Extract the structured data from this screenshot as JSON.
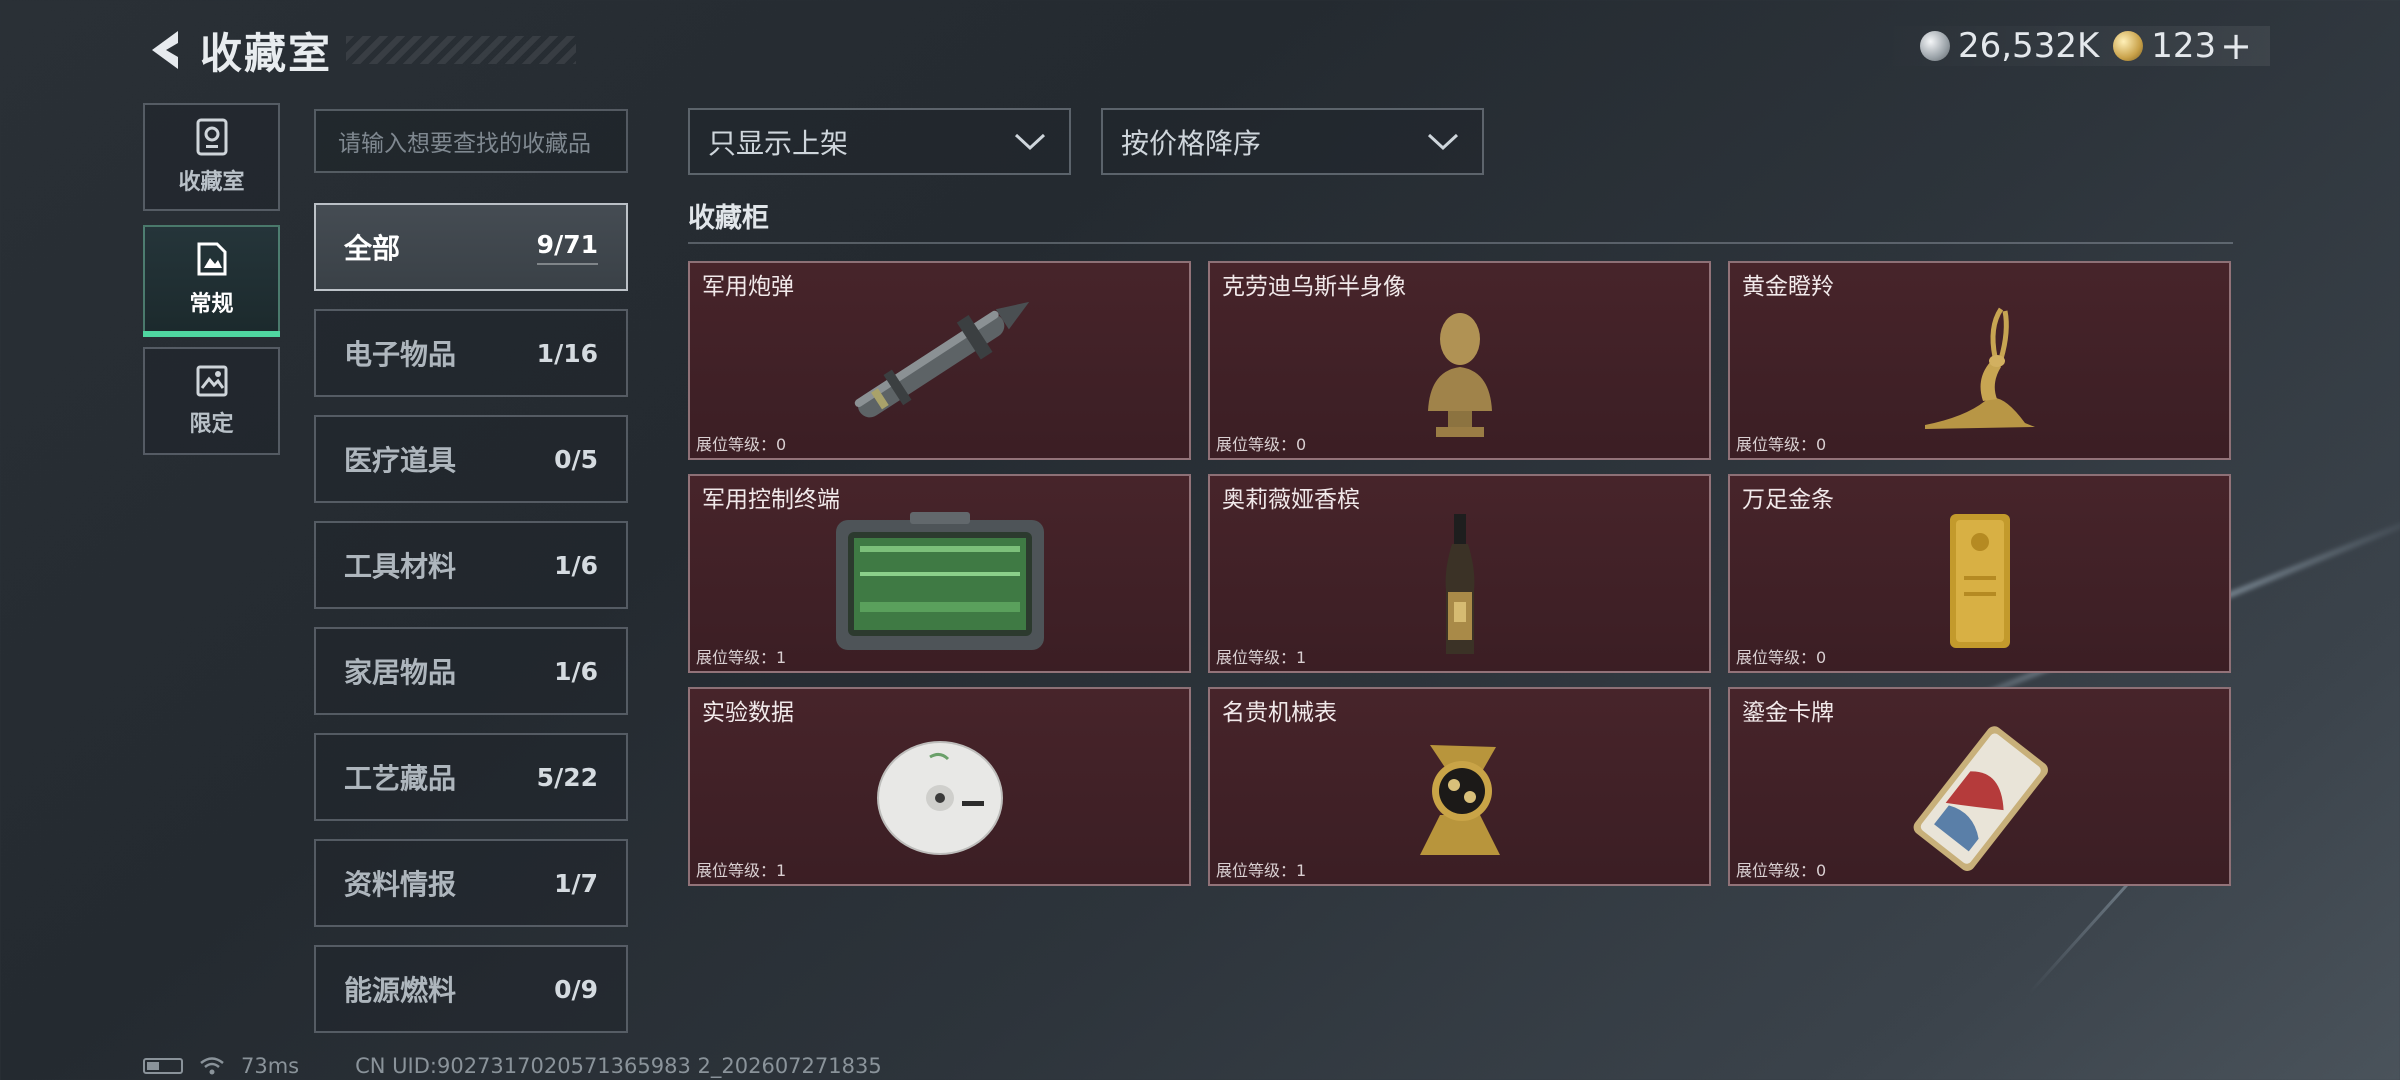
{
  "header": {
    "title": "收藏室"
  },
  "currency": {
    "silver": "26,532K",
    "gold": "123",
    "gold_plus": "+"
  },
  "leftnav": [
    {
      "label": "收藏室",
      "icon": "trophy-icon"
    },
    {
      "label": "常规",
      "icon": "document-icon",
      "active": true
    },
    {
      "label": "限定",
      "icon": "image-icon"
    }
  ],
  "search": {
    "placeholder": "请输入想要查找的收藏品"
  },
  "categories": [
    {
      "name": "全部",
      "count": "9/71",
      "active": true
    },
    {
      "name": "电子物品",
      "count": "1/16"
    },
    {
      "name": "医疗道具",
      "count": "0/5"
    },
    {
      "name": "工具材料",
      "count": "1/6"
    },
    {
      "name": "家居物品",
      "count": "1/6"
    },
    {
      "name": "工艺藏品",
      "count": "5/22"
    },
    {
      "name": "资料情报",
      "count": "1/7"
    },
    {
      "name": "能源燃料",
      "count": "0/9"
    }
  ],
  "filters": {
    "listing": "只显示上架",
    "sort": "按价格降序"
  },
  "section": {
    "title": "收藏柜"
  },
  "items": [
    {
      "name": "军用炮弹",
      "level": "展位等级：0",
      "icon": "missile-icon"
    },
    {
      "name": "克劳迪乌斯半身像",
      "level": "展位等级：0",
      "icon": "bust-icon"
    },
    {
      "name": "黄金瞪羚",
      "level": "展位等级：0",
      "icon": "gazelle-icon"
    },
    {
      "name": "军用控制终端",
      "level": "展位等级：1",
      "icon": "terminal-icon"
    },
    {
      "name": "奥莉薇娅香槟",
      "level": "展位等级：1",
      "icon": "bottle-icon"
    },
    {
      "name": "万足金条",
      "level": "展位等级：0",
      "icon": "gold-bar-icon"
    },
    {
      "name": "实验数据",
      "level": "展位等级：1",
      "icon": "disc-icon"
    },
    {
      "name": "名贵机械表",
      "level": "展位等级：1",
      "icon": "watch-icon"
    },
    {
      "name": "鎏金卡牌",
      "level": "展位等级：0",
      "icon": "card-icon"
    }
  ],
  "footer": {
    "ping": "73ms",
    "uid": "CN UID:9027317020571365983 2_202607271835"
  },
  "colors": {
    "accent": "#4fd6a0",
    "card_bg": "#43222a"
  }
}
